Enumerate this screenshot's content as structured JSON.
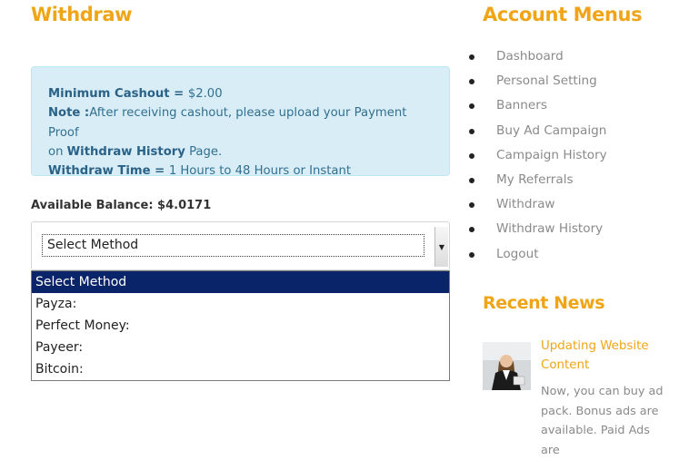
{
  "page": {
    "title": "Withdraw"
  },
  "info": {
    "min_label": "Minimum Cashout = ",
    "min_value": "$2.00",
    "note_label": "Note :",
    "note_text": "After receiving cashout, please upload your Payment Proof",
    "note_on": "on ",
    "note_link": "Withdraw History",
    "note_page": " Page.",
    "time_label": "Withdraw Time = ",
    "time_value": "1 Hours to 48 Hours or Instant"
  },
  "balance": {
    "label": "Available Balance: $4.0171"
  },
  "select": {
    "value": "Select Method",
    "options": [
      "Select Method",
      "Payza:",
      "Perfect Money:",
      "Payeer:",
      "Bitcoin:"
    ]
  },
  "sidebar": {
    "title": "Account Menus",
    "items": [
      {
        "label": "Dashboard"
      },
      {
        "label": "Personal Setting"
      },
      {
        "label": "Banners"
      },
      {
        "label": "Buy Ad Campaign"
      },
      {
        "label": "Campaign History"
      },
      {
        "label": "My Referrals"
      },
      {
        "label": "Withdraw"
      },
      {
        "label": "Withdraw History"
      },
      {
        "label": "Logout"
      }
    ]
  },
  "news": {
    "title": "Recent News",
    "item_title": "Updating Website Content",
    "item_text": "Now, you can buy ad pack. Bonus ads are available. Paid Ads are"
  },
  "colors": {
    "accent": "#f0a517",
    "info_bg": "#d9edf7",
    "info_text": "#31708f",
    "dropdown_selected": "#0a246a"
  }
}
